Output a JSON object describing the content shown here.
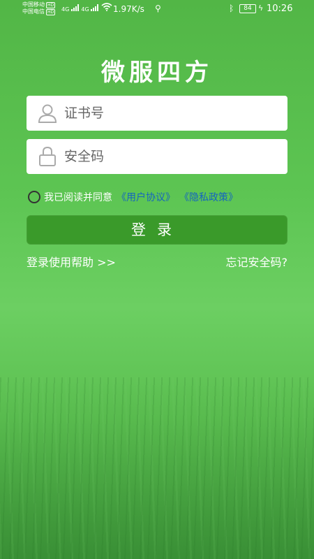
{
  "status_bar": {
    "carrier1": "中国移动",
    "carrier2": "中国电信",
    "hd1": "HD",
    "hd2": "HD",
    "net1": "4G",
    "net2": "4G",
    "speed": "1.97K/s",
    "battery": "84",
    "time": "10:26"
  },
  "app": {
    "title": "微服四方"
  },
  "form": {
    "id_placeholder": "证书号",
    "code_placeholder": "安全码",
    "agree_text": "我已阅读并同意",
    "user_agreement": "《用户协议》",
    "privacy_policy": "《隐私政策》",
    "login_label": "登录",
    "help_link": "登录使用帮助 >>",
    "forgot_link": "忘记安全码?"
  },
  "colors": {
    "background": "#5dc553",
    "button": "#3a9a2a",
    "link": "#1565c0"
  },
  "icons": {
    "id_field": "user-icon",
    "code_field": "lock-icon"
  }
}
